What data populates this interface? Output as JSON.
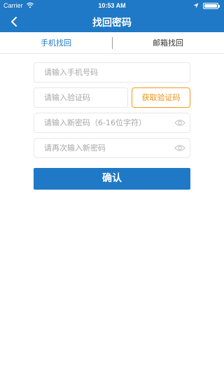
{
  "status_bar": {
    "carrier": "Carrier",
    "time": "10:53 AM",
    "battery_level": 1.0
  },
  "header": {
    "title": "找回密码",
    "back_icon": "chevron-left-icon"
  },
  "tabs": [
    {
      "label": "手机找回",
      "active": true
    },
    {
      "label": "邮箱找回",
      "active": false
    }
  ],
  "form": {
    "phone_placeholder": "请输入手机号码",
    "code_placeholder": "请输入验证码",
    "get_code_label": "获取验证码",
    "new_password_placeholder": "请输入新密码（6-16位字符）",
    "confirm_password_placeholder": "请再次输入新密码",
    "eye_icon": "eye-icon"
  },
  "actions": {
    "confirm_label": "确认"
  },
  "colors": {
    "primary": "#1f79c6",
    "accent": "#f0900f",
    "placeholder": "#a7a7a7",
    "border": "#e8e8e8"
  }
}
